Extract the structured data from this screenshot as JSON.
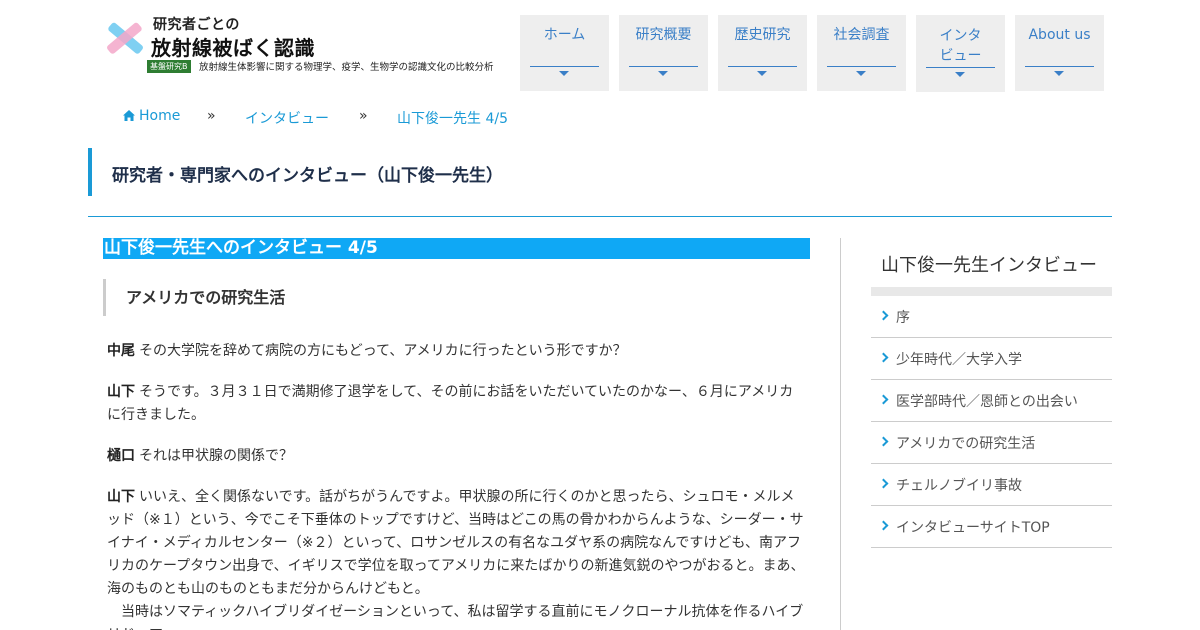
{
  "header": {
    "logo": {
      "title_small": "研究者ごとの",
      "title_big": "放射線被ばく認識",
      "badge": "基盤研究B",
      "subtitle": "放射線生体影響に関する物理学、疫学、生物学の認識文化の比較分析"
    },
    "nav": [
      {
        "label": "ホーム"
      },
      {
        "label": "研究概要"
      },
      {
        "label": "歴史研究"
      },
      {
        "label": "社会調査"
      },
      {
        "label": "インタビュー"
      },
      {
        "label": "About us"
      }
    ]
  },
  "breadcrumb": {
    "home": "Home",
    "separator": "»",
    "section": "インタビュー",
    "current": "山下俊一先生 4/5"
  },
  "page_title": "研究者・専門家へのインタビュー（山下俊一先生）",
  "main": {
    "article_heading": "山下俊一先生へのインタビュー 4/5",
    "section_heading": "アメリカでの研究生活",
    "paragraphs": [
      {
        "speaker": "中尾",
        "text": "その大学院を辞めて病院の方にもどって、アメリカに行ったという形ですか？"
      },
      {
        "speaker": "山下",
        "text": "そうです。３月３１日で満期修了退学をして、その前にお話をいただいていたのかなー、６月にアメリカに行きました。"
      },
      {
        "speaker": "樋口",
        "text": "それは甲状腺の関係で？"
      },
      {
        "speaker": "山下",
        "text": "いいえ、全く関係ないです。話がちがうんですよ。甲状腺の所に行くのかと思ったら、シュロモ・メルメッド（※１）という、今でこそ下垂体のトップですけど、当時はどこの馬の骨かわからんような、シーダー・サイナイ・メディカルセンター（※２）といって、ロサンゼルスの有名なユダヤ系の病院なんですけども、南アフリカのケープタウン出身で、イギリスで学位を取ってアメリカに来たばかりの新進気鋭のやつがおると。まあ、海のものとも山のものともまだ分からんけどもと。"
      },
      {
        "speaker": "",
        "text": "当時はソマティックハイブリダイゼーションといって、私は留学する直前にモノクローナル抗体を作るハイブリドーマ"
      }
    ]
  },
  "sidebar": {
    "title": "山下俊一先生インタビュー",
    "items": [
      {
        "label": "序"
      },
      {
        "label": "少年時代／大学入学"
      },
      {
        "label": "医学部時代／恩師との出会い"
      },
      {
        "label": "アメリカでの研究生活"
      },
      {
        "label": "チェルノブイリ事故"
      },
      {
        "label": "インタビューサイトTOP"
      }
    ]
  },
  "colors": {
    "accent": "#1a9ad6",
    "heading_bg": "#0fa8f5",
    "nav_bg": "#eeeeee",
    "nav_text": "#3a7fc7"
  }
}
